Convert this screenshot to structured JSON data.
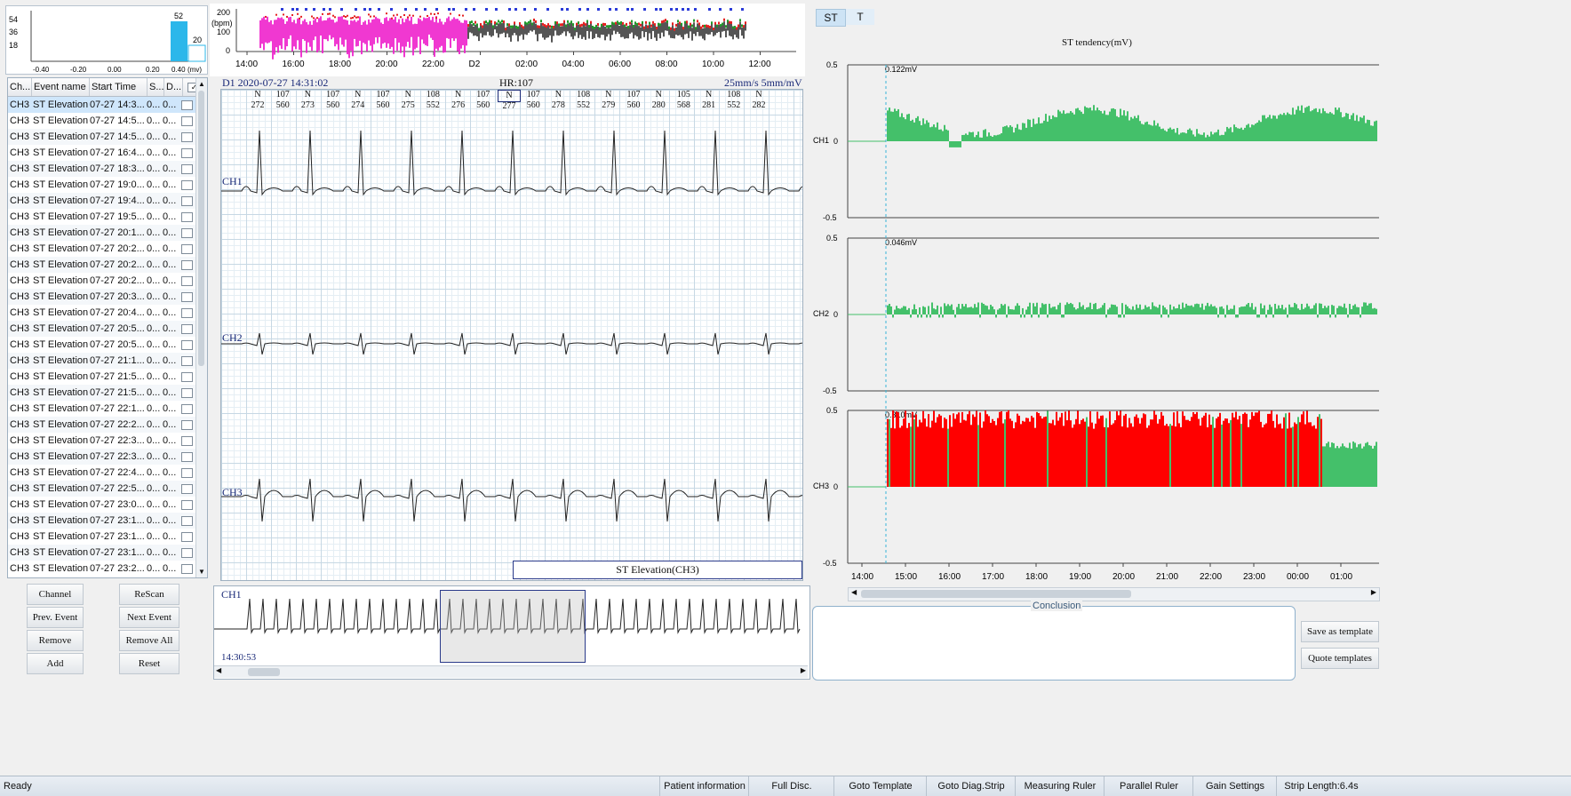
{
  "histogram": {
    "y_ticks": [
      "54",
      "36",
      "18"
    ],
    "x_ticks": [
      "-0.40",
      "-0.20",
      "0.00",
      "0.20",
      "0.40"
    ],
    "x_unit": "(mv)",
    "bars": [
      {
        "x": 0.3,
        "value": 52,
        "label": "52"
      },
      {
        "x": 0.4,
        "value": 20,
        "label": "20"
      }
    ]
  },
  "hr_trend": {
    "y_unit": "(bpm)",
    "y_ticks": [
      "200",
      "100",
      "0"
    ],
    "x_ticks": [
      "14:00",
      "16:00",
      "18:00",
      "20:00",
      "22:00",
      "D2",
      "02:00",
      "04:00",
      "06:00",
      "08:00",
      "10:00",
      "12:00"
    ]
  },
  "table": {
    "headers": [
      "Ch...",
      "Event name",
      "Start Time",
      "S...",
      "D..."
    ],
    "rows": [
      [
        "CH3",
        "ST Elevation",
        "07-27 14:3...",
        "0...",
        "0..."
      ],
      [
        "CH3",
        "ST Elevation",
        "07-27 14:5...",
        "0...",
        "0..."
      ],
      [
        "CH3",
        "ST Elevation",
        "07-27 14:5...",
        "0...",
        "0..."
      ],
      [
        "CH3",
        "ST Elevation",
        "07-27 16:4...",
        "0...",
        "0..."
      ],
      [
        "CH3",
        "ST Elevation",
        "07-27 18:3...",
        "0...",
        "0..."
      ],
      [
        "CH3",
        "ST Elevation",
        "07-27 19:0...",
        "0...",
        "0..."
      ],
      [
        "CH3",
        "ST Elevation",
        "07-27 19:4...",
        "0...",
        "0..."
      ],
      [
        "CH3",
        "ST Elevation",
        "07-27 19:5...",
        "0...",
        "0..."
      ],
      [
        "CH3",
        "ST Elevation",
        "07-27 20:1...",
        "0...",
        "0..."
      ],
      [
        "CH3",
        "ST Elevation",
        "07-27 20:2...",
        "0...",
        "0..."
      ],
      [
        "CH3",
        "ST Elevation",
        "07-27 20:2...",
        "0...",
        "0..."
      ],
      [
        "CH3",
        "ST Elevation",
        "07-27 20:2...",
        "0...",
        "0..."
      ],
      [
        "CH3",
        "ST Elevation",
        "07-27 20:3...",
        "0...",
        "0..."
      ],
      [
        "CH3",
        "ST Elevation",
        "07-27 20:4...",
        "0...",
        "0..."
      ],
      [
        "CH3",
        "ST Elevation",
        "07-27 20:5...",
        "0...",
        "0..."
      ],
      [
        "CH3",
        "ST Elevation",
        "07-27 20:5...",
        "0...",
        "0..."
      ],
      [
        "CH3",
        "ST Elevation",
        "07-27 21:1...",
        "0...",
        "0..."
      ],
      [
        "CH3",
        "ST Elevation",
        "07-27 21:5...",
        "0...",
        "0..."
      ],
      [
        "CH3",
        "ST Elevation",
        "07-27 21:5...",
        "0...",
        "0..."
      ],
      [
        "CH3",
        "ST Elevation",
        "07-27 22:1...",
        "0...",
        "0..."
      ],
      [
        "CH3",
        "ST Elevation",
        "07-27 22:2...",
        "0...",
        "0..."
      ],
      [
        "CH3",
        "ST Elevation",
        "07-27 22:3...",
        "0...",
        "0..."
      ],
      [
        "CH3",
        "ST Elevation",
        "07-27 22:3...",
        "0...",
        "0..."
      ],
      [
        "CH3",
        "ST Elevation",
        "07-27 22:4...",
        "0...",
        "0..."
      ],
      [
        "CH3",
        "ST Elevation",
        "07-27 22:5...",
        "0...",
        "0..."
      ],
      [
        "CH3",
        "ST Elevation",
        "07-27 23:0...",
        "0...",
        "0..."
      ],
      [
        "CH3",
        "ST Elevation",
        "07-27 23:1...",
        "0...",
        "0..."
      ],
      [
        "CH3",
        "ST Elevation",
        "07-27 23:1...",
        "0...",
        "0..."
      ],
      [
        "CH3",
        "ST Elevation",
        "07-27 23:1...",
        "0...",
        "0..."
      ],
      [
        "CH3",
        "ST Elevation",
        "07-27 23:2...",
        "0...",
        "0..."
      ]
    ]
  },
  "buttons": {
    "channel": "Channel",
    "rescan": "ReScan",
    "prev_event": "Prev. Event",
    "next_event": "Next Event",
    "remove": "Remove",
    "remove_all": "Remove All",
    "add": "Add",
    "reset": "Reset"
  },
  "ecg": {
    "title": "D1 2020-07-27 14:31:02",
    "hr": "HR:107",
    "speed": "25mm/s 5mm/mV",
    "beat_labels": [
      "N",
      "107",
      "N",
      "107",
      "N",
      "107",
      "N",
      "108",
      "N",
      "107",
      "N",
      "107",
      "N",
      "108",
      "N",
      "107",
      "N",
      "105",
      "N",
      "108",
      "N"
    ],
    "beat_values": [
      "272",
      "560",
      "273",
      "560",
      "274",
      "560",
      "275",
      "552",
      "276",
      "560",
      "277",
      "560",
      "278",
      "552",
      "279",
      "560",
      "280",
      "568",
      "281",
      "552",
      "282"
    ],
    "channels": [
      "CH1",
      "CH2",
      "CH3"
    ],
    "event_label": "ST Elevation(CH3)"
  },
  "overview": {
    "channel": "CH1",
    "time": "14:30:53"
  },
  "st_panel": {
    "tabs": [
      "ST",
      "T"
    ],
    "title": "ST tendency(mV)",
    "charts": [
      {
        "channel": "CH1",
        "value": "0.122mV",
        "ymax": "0.5",
        "zero": "0",
        "ymin": "-0.5"
      },
      {
        "channel": "CH2",
        "value": "0.046mV",
        "ymax": "0.5",
        "zero": "0",
        "ymin": "-0.5"
      },
      {
        "channel": "CH3",
        "value": "0.310mV",
        "ymax": "0.5",
        "zero": "0",
        "ymin": "-0.5"
      }
    ],
    "x_ticks": [
      "14:00",
      "15:00",
      "16:00",
      "17:00",
      "18:00",
      "19:00",
      "20:00",
      "21:00",
      "22:00",
      "23:00",
      "00:00",
      "01:00"
    ]
  },
  "conclusion": {
    "label": "Conclusion",
    "save_template": "Save as template",
    "quote_templates": "Quote templates"
  },
  "statusbar": {
    "ready": "Ready",
    "items": [
      "Patient information",
      "Full Disc.",
      "Goto Template",
      "Goto Diag.Strip",
      "Measuring Ruler",
      "Parallel Ruler",
      "Gain Settings",
      "Strip Length:6.4s"
    ]
  },
  "colors": {
    "st_green": "#44c06a",
    "st_red": "#ff0000",
    "ecg_ink": "#222222",
    "label_blue": "#1a2a78"
  }
}
